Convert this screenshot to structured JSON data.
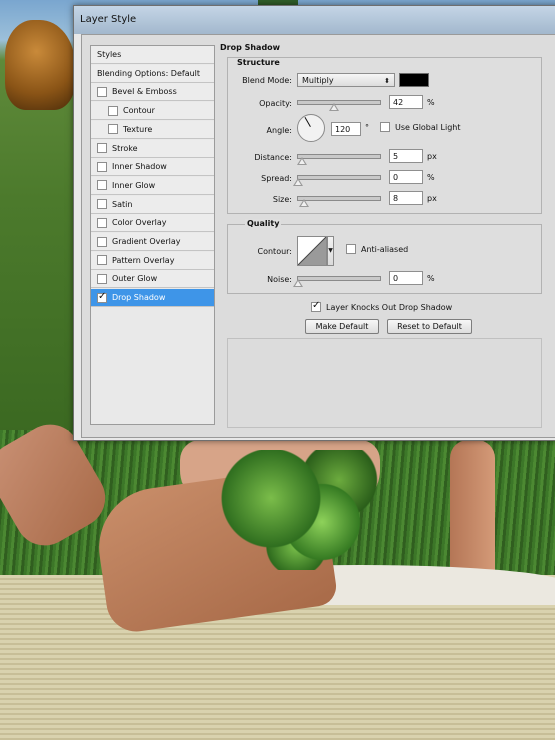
{
  "window": {
    "title": "Layer Style"
  },
  "styles_panel": {
    "items": [
      {
        "label": "Styles",
        "has_checkbox": false,
        "checked": false,
        "selected": false,
        "indent": 0
      },
      {
        "label": "Blending Options: Default",
        "has_checkbox": false,
        "checked": false,
        "selected": false,
        "indent": 0
      },
      {
        "label": "Bevel & Emboss",
        "has_checkbox": true,
        "checked": false,
        "selected": false,
        "indent": 0
      },
      {
        "label": "Contour",
        "has_checkbox": true,
        "checked": false,
        "selected": false,
        "indent": 1
      },
      {
        "label": "Texture",
        "has_checkbox": true,
        "checked": false,
        "selected": false,
        "indent": 1
      },
      {
        "label": "Stroke",
        "has_checkbox": true,
        "checked": false,
        "selected": false,
        "indent": 0
      },
      {
        "label": "Inner Shadow",
        "has_checkbox": true,
        "checked": false,
        "selected": false,
        "indent": 0
      },
      {
        "label": "Inner Glow",
        "has_checkbox": true,
        "checked": false,
        "selected": false,
        "indent": 0
      },
      {
        "label": "Satin",
        "has_checkbox": true,
        "checked": false,
        "selected": false,
        "indent": 0
      },
      {
        "label": "Color Overlay",
        "has_checkbox": true,
        "checked": false,
        "selected": false,
        "indent": 0
      },
      {
        "label": "Gradient Overlay",
        "has_checkbox": true,
        "checked": false,
        "selected": false,
        "indent": 0
      },
      {
        "label": "Pattern Overlay",
        "has_checkbox": true,
        "checked": false,
        "selected": false,
        "indent": 0
      },
      {
        "label": "Outer Glow",
        "has_checkbox": true,
        "checked": false,
        "selected": false,
        "indent": 0
      },
      {
        "label": "Drop Shadow",
        "has_checkbox": true,
        "checked": true,
        "selected": true,
        "indent": 0
      }
    ]
  },
  "drop_shadow": {
    "section_title": "Drop Shadow",
    "structure": {
      "title": "Structure",
      "blend_mode_label": "Blend Mode:",
      "blend_mode_value": "Multiply",
      "shadow_color": "#000000",
      "opacity_label": "Opacity:",
      "opacity_value": "42",
      "opacity_unit": "%",
      "angle_label": "Angle:",
      "angle_value": "120",
      "angle_unit": "°",
      "use_global_light_label": "Use Global Light",
      "use_global_light_checked": false,
      "distance_label": "Distance:",
      "distance_value": "5",
      "distance_unit": "px",
      "spread_label": "Spread:",
      "spread_value": "0",
      "spread_unit": "%",
      "size_label": "Size:",
      "size_value": "8",
      "size_unit": "px"
    },
    "quality": {
      "title": "Quality",
      "contour_label": "Contour:",
      "anti_aliased_label": "Anti-aliased",
      "anti_aliased_checked": false,
      "noise_label": "Noise:",
      "noise_value": "0",
      "noise_unit": "%"
    },
    "knocks_out_label": "Layer Knocks Out Drop Shadow",
    "knocks_out_checked": true,
    "make_default_label": "Make Default",
    "reset_default_label": "Reset to Default"
  },
  "colors": {
    "selection": "#3e95e8"
  }
}
